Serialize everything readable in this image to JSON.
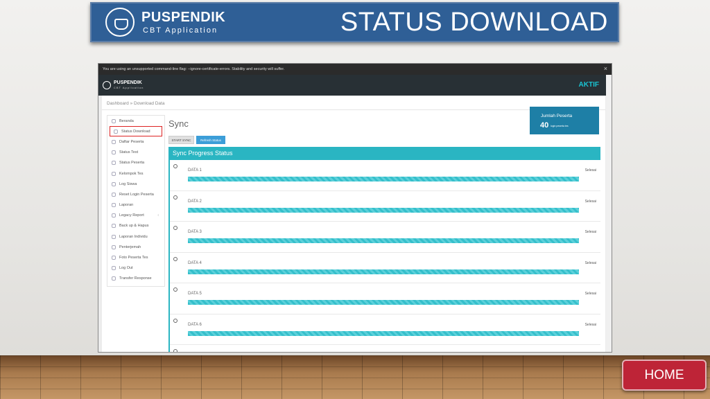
{
  "slide": {
    "brand": "PUSPENDIK",
    "brand_sub": "CBT Application",
    "title": "STATUS DOWNLOAD",
    "home_label": "HOME"
  },
  "browser": {
    "warning": "You are using an unsupported command-line flag: --ignore-certificate-errors. Stability and security will suffer.",
    "close": "×"
  },
  "app": {
    "brand": "PUSPENDIK",
    "brand_sub": "CBT Application",
    "status": "AKTIF",
    "breadcrumb": "Dashboard » Download Data"
  },
  "sidebar": {
    "items": [
      {
        "label": "Beranda"
      },
      {
        "label": "Status Download"
      },
      {
        "label": "Daftar Peserta"
      },
      {
        "label": "Status Test"
      },
      {
        "label": "Status Peserta"
      },
      {
        "label": "Kelompok Tes"
      },
      {
        "label": "Log Siswa"
      },
      {
        "label": "Reset Login Peserta"
      },
      {
        "label": "Laporan"
      },
      {
        "label": "Legacy Report"
      },
      {
        "label": "Back up & Hapus"
      },
      {
        "label": "Laporan Individu"
      },
      {
        "label": "Penterjemah"
      },
      {
        "label": "Foto Peserta Tes"
      },
      {
        "label": "Log Out"
      },
      {
        "label": "Transfer Response"
      }
    ]
  },
  "main": {
    "title": "Sync",
    "start_label": "START SYNC",
    "refresh_label": "Refresh Status",
    "progress_title": "Sync Progress Status",
    "stat": {
      "label": "Jumlah Peserta",
      "value": "40",
      "unit": "login peserta tes"
    },
    "rows": [
      {
        "name": "DATA 1",
        "status": "Selesai",
        "progress": 1.0
      },
      {
        "name": "DATA 2",
        "status": "Selesai",
        "progress": 1.0
      },
      {
        "name": "DATA 3",
        "status": "Selesai",
        "progress": 1.0
      },
      {
        "name": "DATA 4",
        "status": "Selesai",
        "progress": 1.0
      },
      {
        "name": "DATA 5",
        "status": "Selesai",
        "progress": 1.0
      },
      {
        "name": "DATA 6",
        "status": "Selesai",
        "progress": 1.0
      }
    ]
  },
  "colors": {
    "banner": "#2f5f96",
    "accent": "#2ab5c2",
    "home": "#be2437"
  }
}
